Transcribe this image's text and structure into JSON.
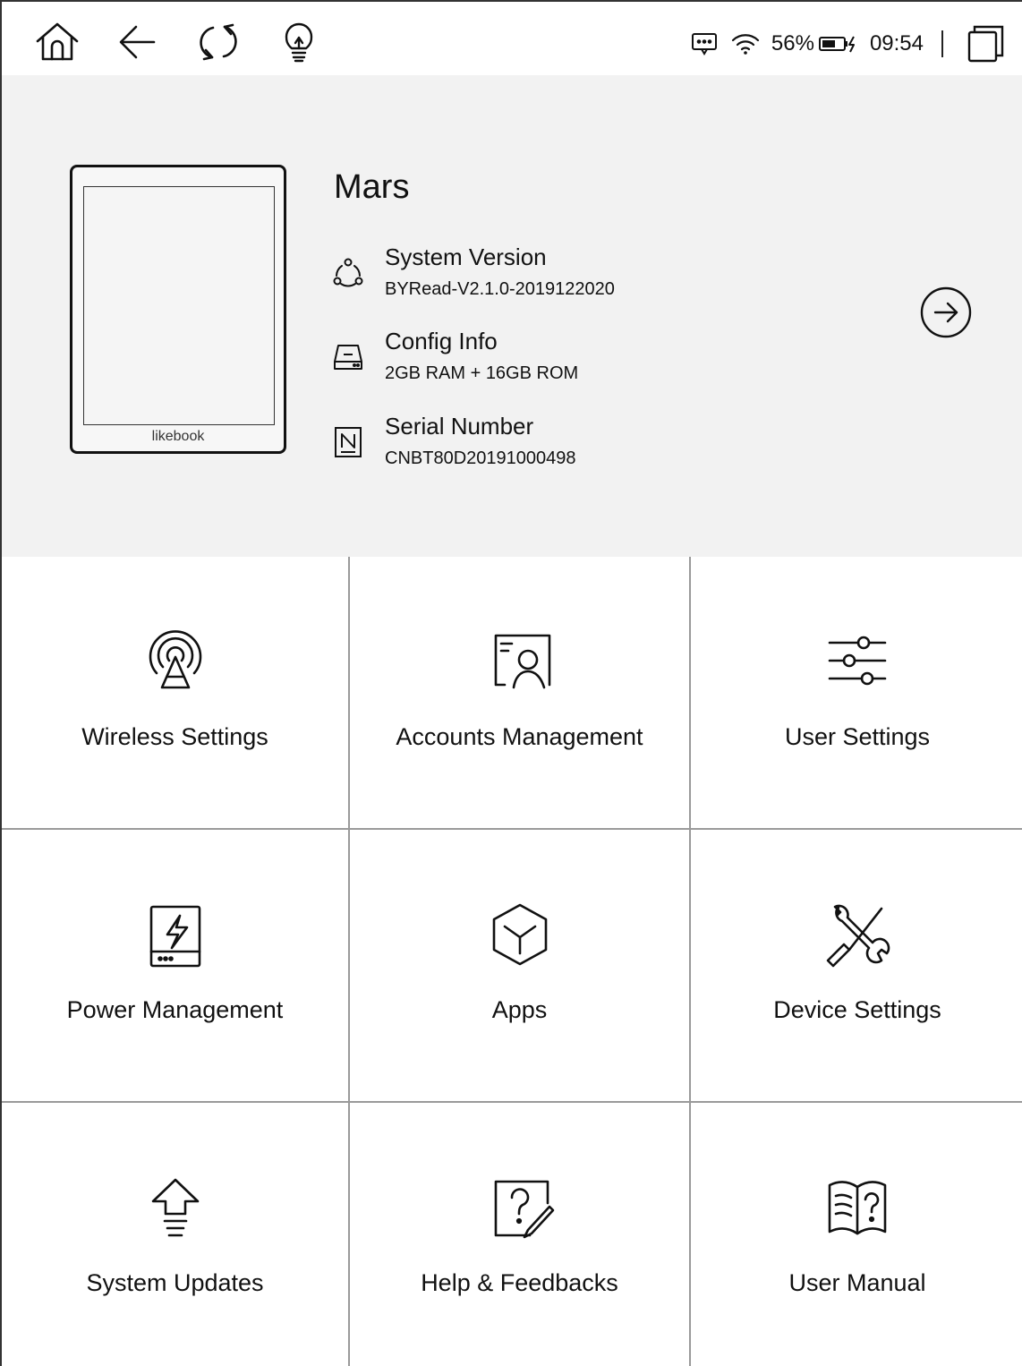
{
  "status_bar": {
    "nav_icons": [
      "home-icon",
      "back-icon",
      "refresh-icon",
      "light-bulb-icon"
    ],
    "right_icons": [
      "message-icon",
      "wifi-icon",
      "battery-charging-icon",
      "multi-window-icon"
    ],
    "battery": "56%",
    "time": "09:54"
  },
  "device": {
    "name": "Mars",
    "brand": "likebook",
    "system_version_label": "System Version",
    "system_version_value": "BYRead-V2.1.0-2019122020",
    "config_label": "Config Info",
    "config_value": "2GB RAM + 16GB ROM",
    "serial_label": "Serial Number",
    "serial_value": "CNBT80D20191000498",
    "next_icon": "arrow-right-circle-icon"
  },
  "menu": {
    "items": [
      {
        "label": "Wireless Settings",
        "icon": "wireless-icon"
      },
      {
        "label": "Accounts Management",
        "icon": "account-icon"
      },
      {
        "label": "User Settings",
        "icon": "sliders-icon"
      },
      {
        "label": "Power Management",
        "icon": "power-icon"
      },
      {
        "label": "Apps",
        "icon": "apps-box-icon"
      },
      {
        "label": "Device Settings",
        "icon": "tools-icon"
      },
      {
        "label": "System Updates",
        "icon": "update-arrow-icon"
      },
      {
        "label": "Help & Feedbacks",
        "icon": "help-edit-icon"
      },
      {
        "label": "User Manual",
        "icon": "manual-book-icon"
      }
    ]
  }
}
